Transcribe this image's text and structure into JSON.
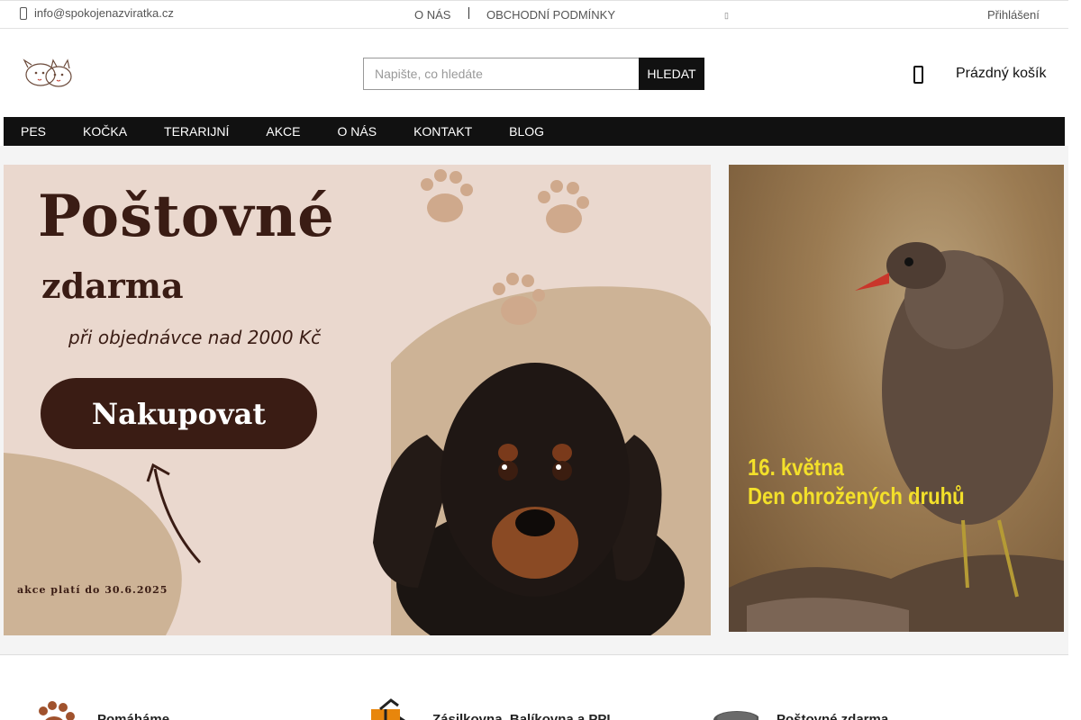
{
  "topbar": {
    "email": "info@spokojenazviratka.cz",
    "about_link": "O NÁS",
    "terms_link": "OBCHODNÍ PODMÍNKY",
    "login_link": "Přihlášení"
  },
  "header": {
    "search_placeholder": "Napište, co hledáte",
    "search_button": "HLEDAT",
    "cart_label": "Prázdný košík"
  },
  "nav": {
    "items": [
      {
        "label": "PES"
      },
      {
        "label": "KOČKA"
      },
      {
        "label": "TERARIJNÍ"
      },
      {
        "label": "AKCE"
      },
      {
        "label": "O NÁS"
      },
      {
        "label": "KONTAKT"
      },
      {
        "label": "BLOG"
      }
    ]
  },
  "banner_left": {
    "title": "Poštovné",
    "subtitle": "zdarma",
    "note": "při objednávce nad 2000 Kč",
    "button": "Nakupovat",
    "validity": "akce platí do 30.6.2025"
  },
  "banner_right": {
    "line1": "16. května",
    "line2": "Den ohrožených druhů"
  },
  "features": [
    {
      "title": "Pomáháme",
      "icon": "paw-icon"
    },
    {
      "title": "Zásilkovna, Balíkovna a PPL",
      "icon": "package-icon"
    },
    {
      "title": "Poštovné zdarma",
      "icon": "truck-icon"
    }
  ],
  "colors": {
    "nav_bg": "#111111",
    "banner_bg": "#ead8ce",
    "banner_brown": "#3a1c14",
    "banner_yellow": "#f3e02a",
    "paw": "#a0522d"
  }
}
